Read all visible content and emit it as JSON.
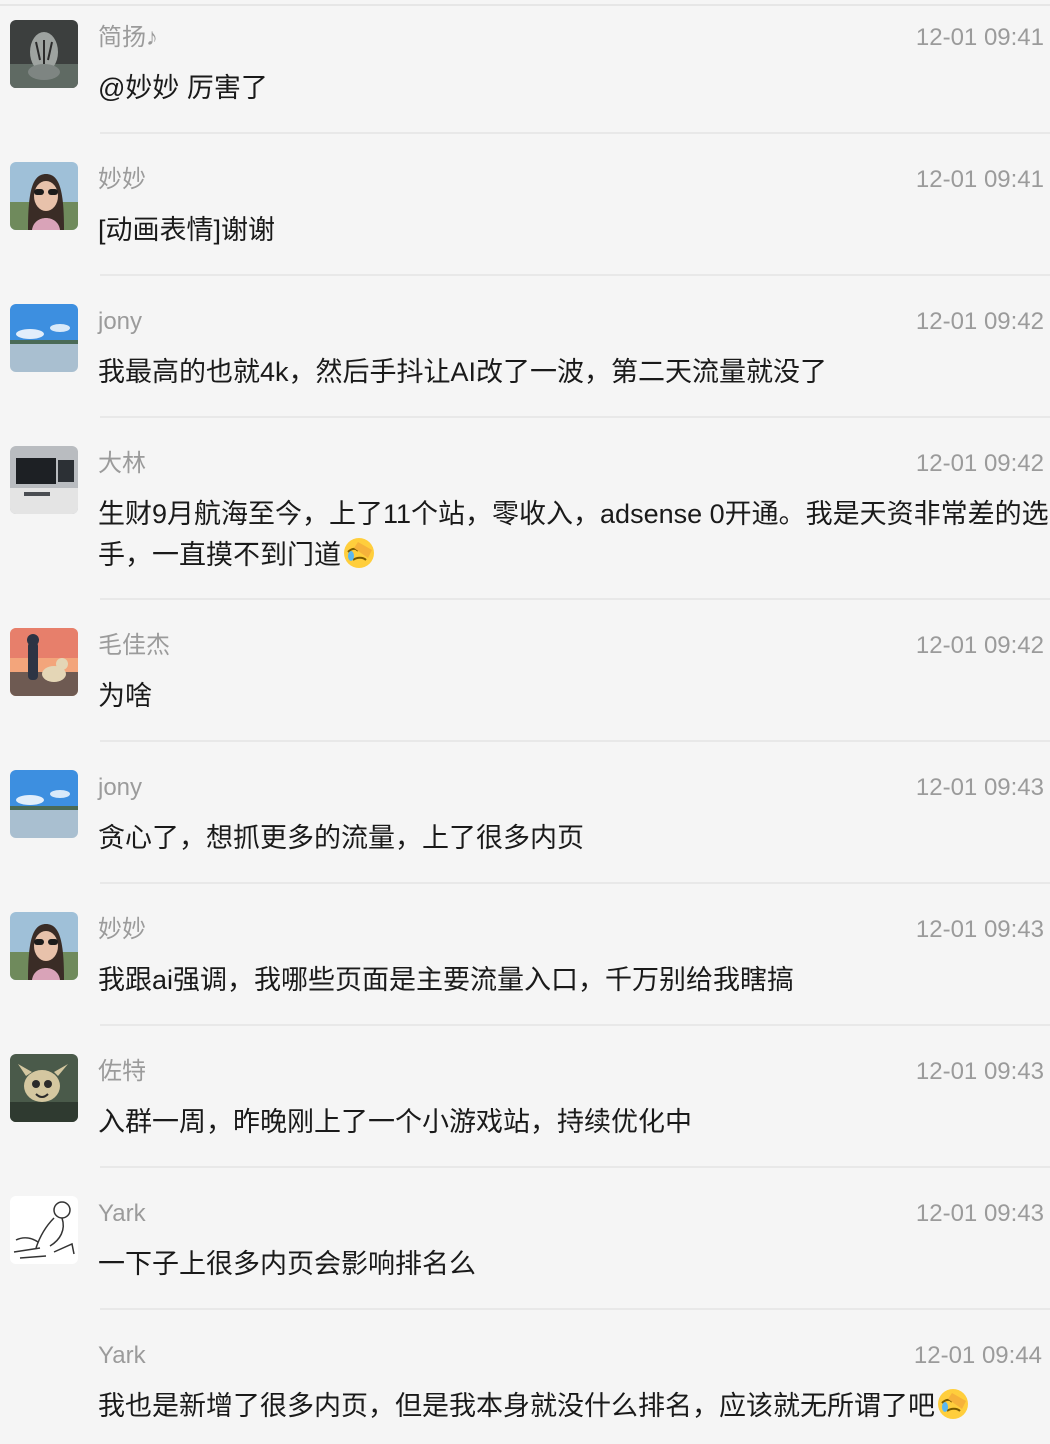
{
  "messages": [
    {
      "name": "简扬♪",
      "time": "12-01 09:41",
      "text": "@妙妙 厉害了",
      "avatar": "tiger-avatar",
      "emoji": false
    },
    {
      "name": "妙妙",
      "time": "12-01 09:41",
      "text": "[动画表情]谢谢",
      "avatar": "woman-sunglasses-avatar",
      "emoji": false
    },
    {
      "name": "jony",
      "time": "12-01 09:42",
      "text": "我最高的也就4k，然后手抖让AI改了一波，第二天流量就没了",
      "avatar": "lake-sky-avatar",
      "emoji": false
    },
    {
      "name": "大林",
      "time": "12-01 09:42",
      "text": "生财9月航海至今，上了11个站，零收入，adsense 0开通。我是天资非常差的选手，一直摸不到门道",
      "avatar": "monitor-desk-avatar",
      "emoji": true
    },
    {
      "name": "毛佳杰",
      "time": "12-01 09:42",
      "text": "为啥",
      "avatar": "boy-dog-sunset-avatar",
      "emoji": false
    },
    {
      "name": "jony",
      "time": "12-01 09:43",
      "text": "贪心了，想抓更多的流量，上了很多内页",
      "avatar": "lake-sky-avatar",
      "emoji": false
    },
    {
      "name": "妙妙",
      "time": "12-01 09:43",
      "text": "我跟ai强调，我哪些页面是主要流量入口，千万别给我瞎搞",
      "avatar": "woman-sunglasses-avatar",
      "emoji": false
    },
    {
      "name": "佐特",
      "time": "12-01 09:43",
      "text": "入群一周，昨晚刚上了一个小游戏站，持续优化中",
      "avatar": "cartoon-creature-avatar",
      "emoji": false
    },
    {
      "name": "Yark",
      "time": "12-01 09:43",
      "text": "一下子上很多内页会影响排名么",
      "avatar": "line-sketch-avatar",
      "emoji": false
    },
    {
      "name": "Yark",
      "time": "12-01 09:44",
      "text": "我也是新增了很多内页，但是我本身就没什么排名，应该就无所谓了吧",
      "avatar": "",
      "emoji": true
    }
  ],
  "emoji_icon": "facepalm-emoji-icon"
}
